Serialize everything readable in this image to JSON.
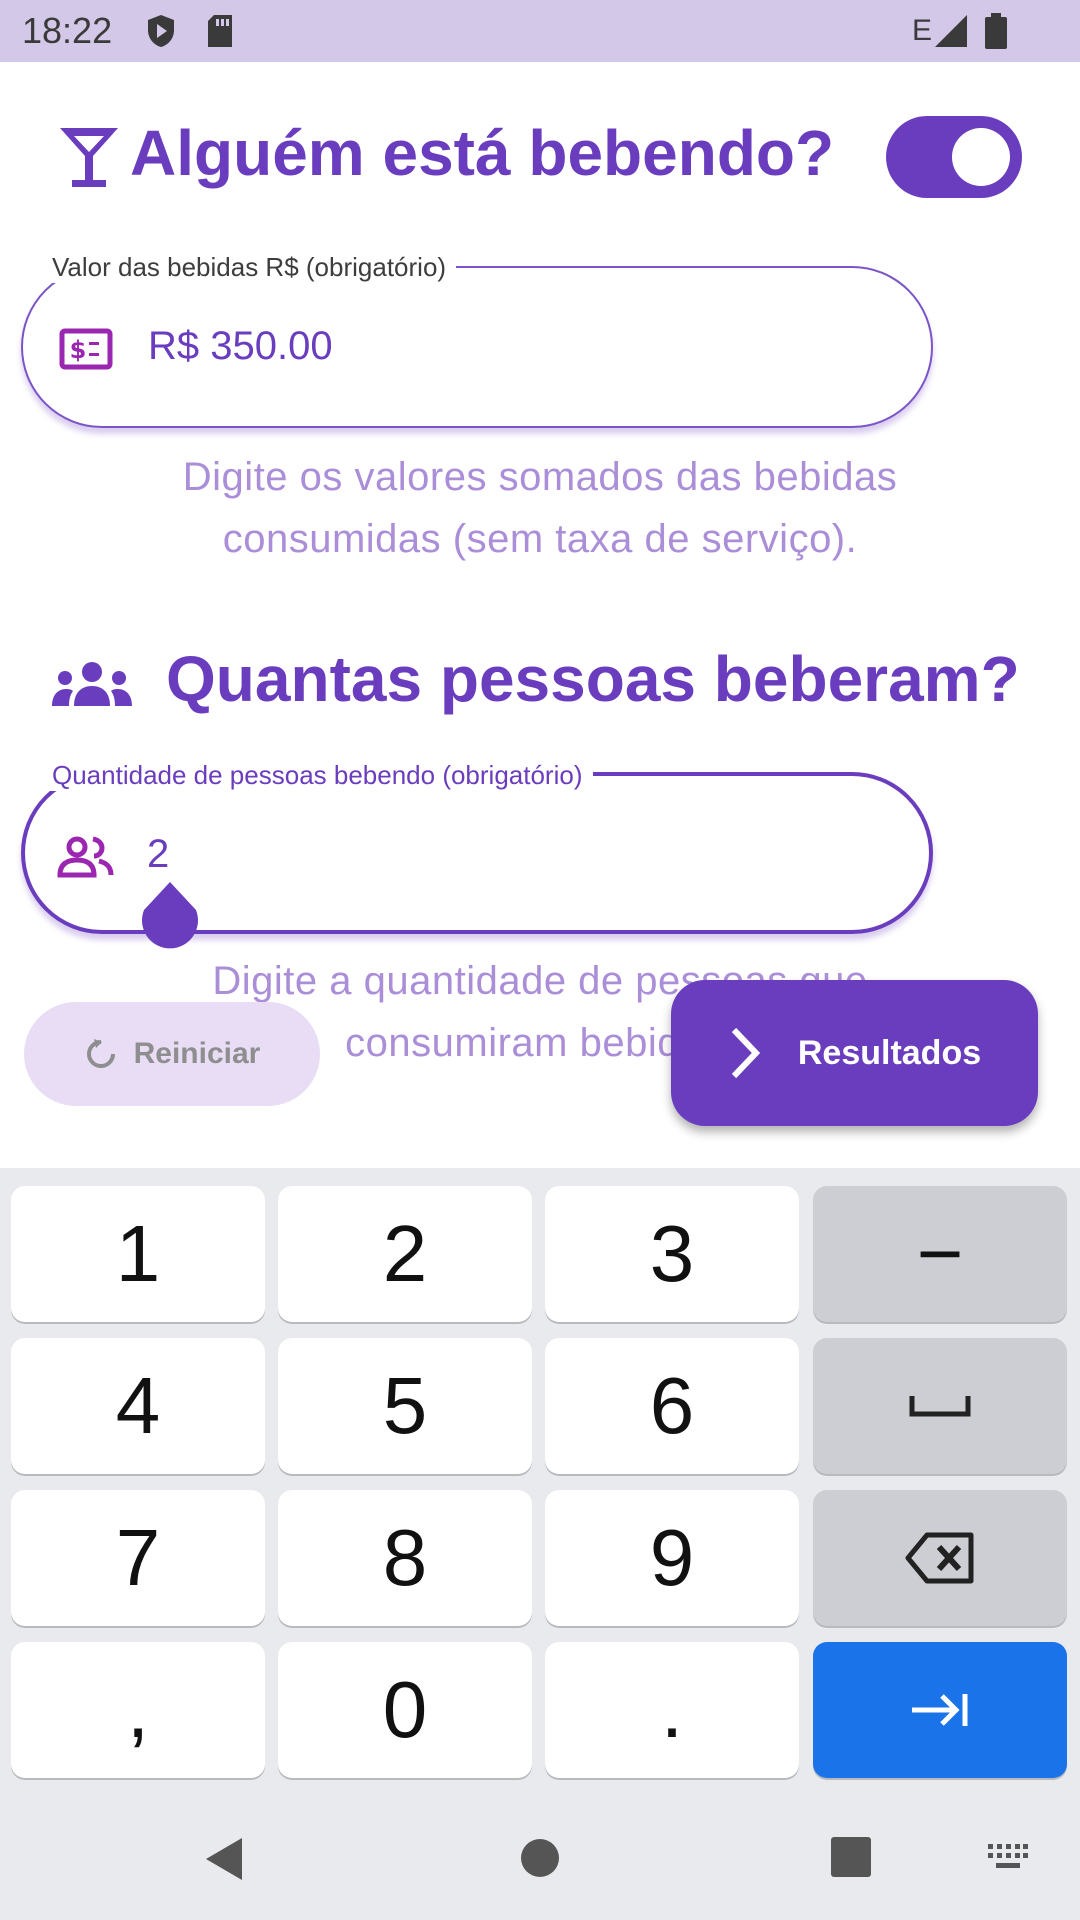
{
  "status_bar": {
    "time": "18:22",
    "network": "E"
  },
  "drinking": {
    "title": "Alguém está bebendo?",
    "toggle_on": true
  },
  "drinks_value": {
    "label": "Valor das bebidas R$ (obrigatório)",
    "value": "R$ 350.00",
    "helper_line1": "Digite os valores somados das bebidas",
    "helper_line2": "consumidas (sem taxa de serviço)."
  },
  "people": {
    "title": "Quantas pessoas beberam?",
    "label": "Quantidade de pessoas bebendo (obrigatório)",
    "value": "2",
    "helper_line1": "Digite a quantidade de pessoas que",
    "helper_line2": "consumiram bebidas."
  },
  "buttons": {
    "reset_label": "Reiniciar",
    "results_label": "Resultados"
  },
  "keyboard": {
    "row1": [
      "1",
      "2",
      "3",
      "−"
    ],
    "row2": [
      "4",
      "5",
      "6"
    ],
    "row3": [
      "7",
      "8",
      "9"
    ],
    "row4": [
      ",",
      "0",
      "."
    ]
  },
  "colors": {
    "primary": "#6a3dbf",
    "helper_text": "#ab8ed8",
    "status_bar": "#d3c8e8",
    "enter_key": "#1a73e8"
  }
}
